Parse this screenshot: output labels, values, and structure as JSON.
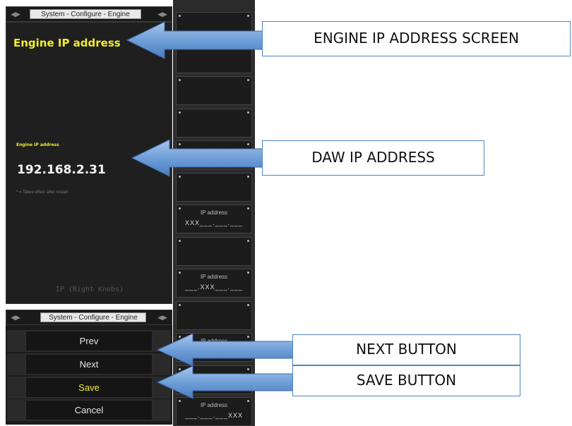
{
  "window": {
    "title": "System - Configure - Engine",
    "heading": "Engine IP address"
  },
  "field": {
    "label": "Engine IP address",
    "value": "192.168.2.31",
    "note": "* = Takes effect after restart",
    "knob_hint": "IP (Right Knobs)"
  },
  "bottom": {
    "title": "System - Configure - Engine",
    "buttons": {
      "prev": "Prev",
      "next": "Next",
      "save": "Save",
      "cancel": "Cancel"
    }
  },
  "tiles": [
    {
      "caption": "",
      "value": ""
    },
    {
      "caption": "",
      "value": ""
    },
    {
      "caption": "",
      "value": ""
    },
    {
      "caption": "",
      "value": ""
    },
    {
      "caption": "",
      "value": ""
    },
    {
      "caption": "",
      "value": ""
    },
    {
      "caption": "IP address",
      "value": "XXX___.___.___"
    },
    {
      "caption": "",
      "value": ""
    },
    {
      "caption": "IP address",
      "value": "___.XXX___.___"
    },
    {
      "caption": "",
      "value": ""
    },
    {
      "caption": "IP address",
      "value": ""
    },
    {
      "caption": "",
      "value": ""
    },
    {
      "caption": "IP address",
      "value": "___.___.___XXX"
    }
  ],
  "callouts": {
    "engine_screen": "ENGINE IP ADDRESS SCREEN",
    "daw_ip": "DAW IP ADDRESS",
    "next_button": "NEXT BUTTON",
    "save_button": "SAVE BUTTON"
  },
  "colors": {
    "heading": "#f2ee2c",
    "callout_border": "#4f86c6",
    "arrow_fill": "#6f9fd8",
    "save_text": "#f2ee2c"
  }
}
